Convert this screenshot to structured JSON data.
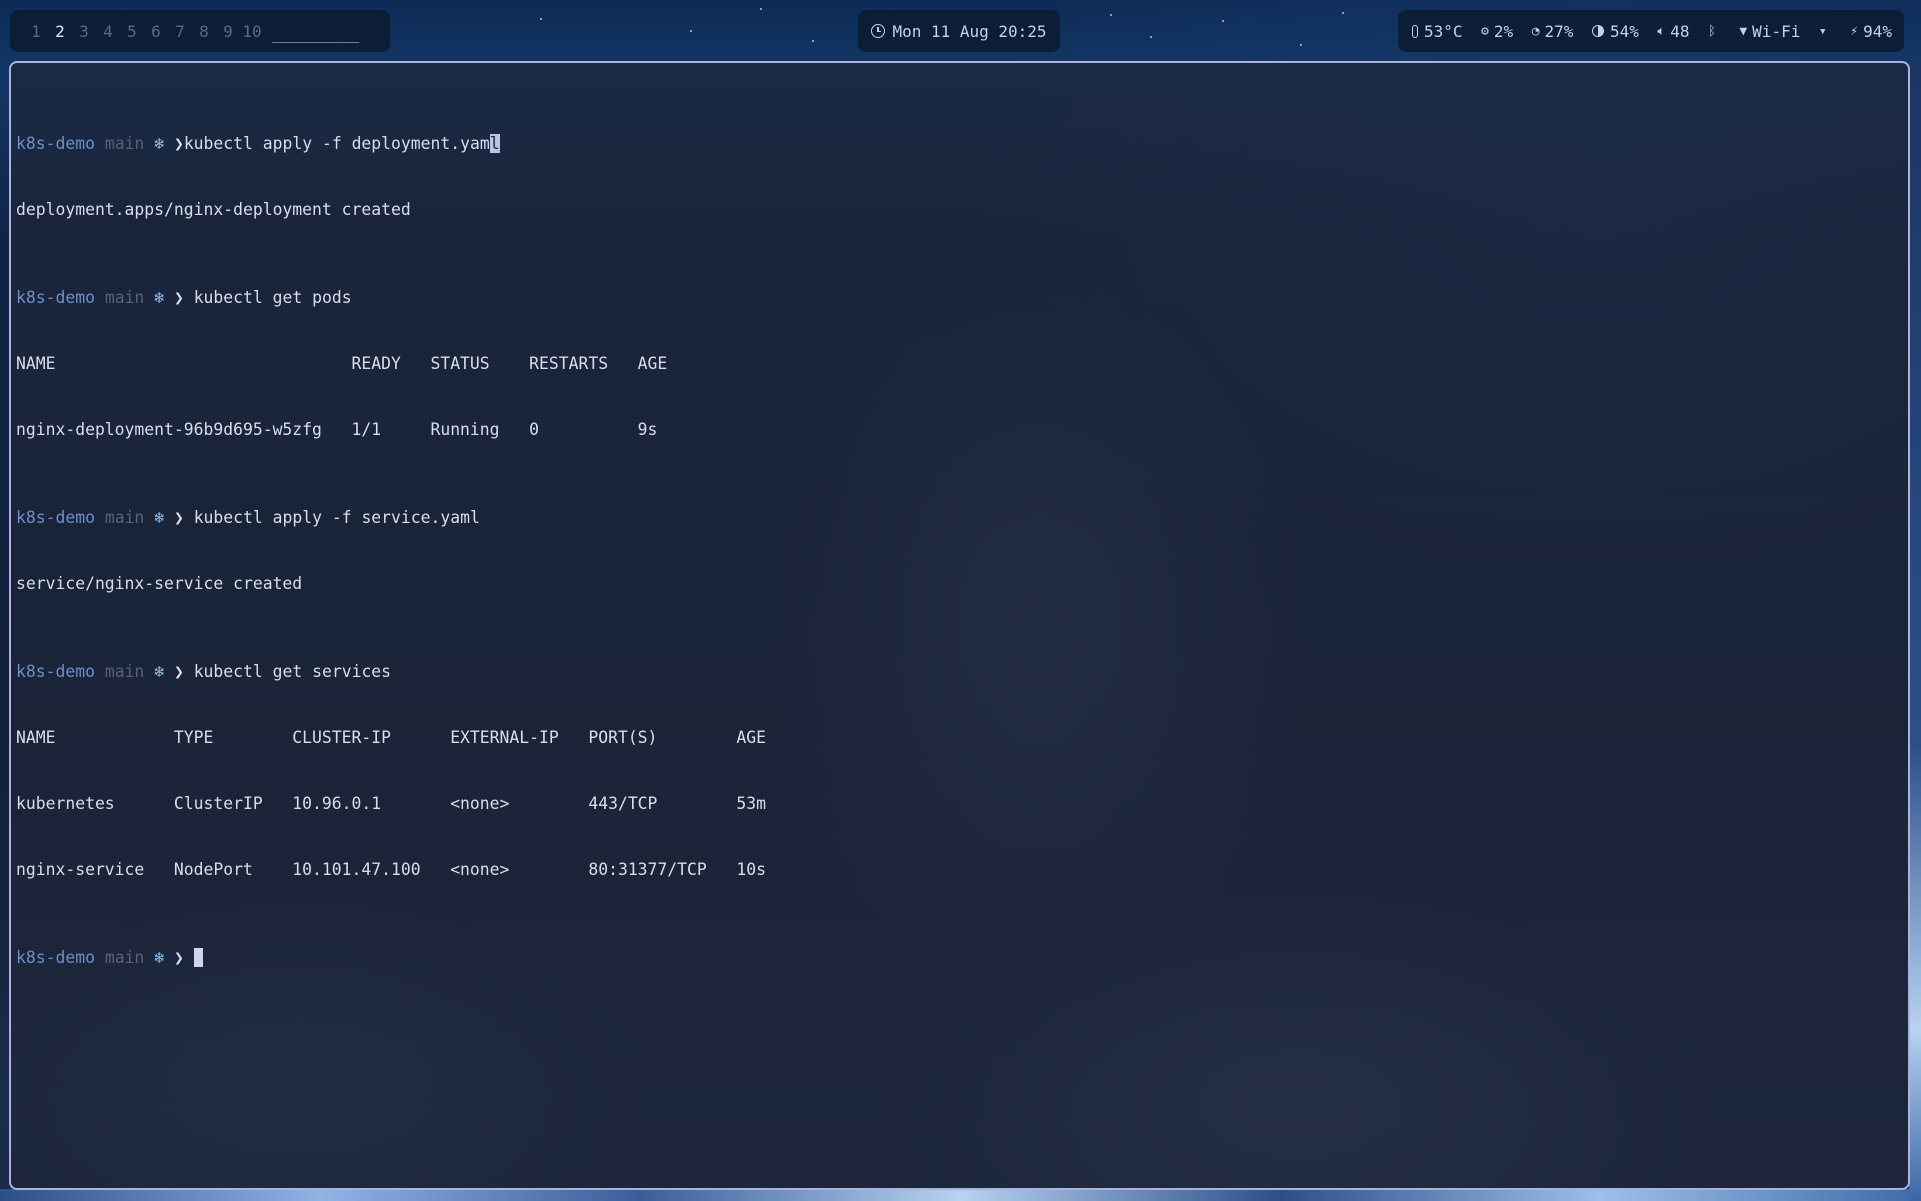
{
  "topbar": {
    "workspaces": [
      {
        "label": "1",
        "active": false
      },
      {
        "label": "2",
        "active": true
      },
      {
        "label": "3",
        "active": false
      },
      {
        "label": "4",
        "active": false
      },
      {
        "label": "5",
        "active": false
      },
      {
        "label": "6",
        "active": false
      },
      {
        "label": "7",
        "active": false
      },
      {
        "label": "8",
        "active": false
      },
      {
        "label": "9",
        "active": false
      },
      {
        "label": "10",
        "active": false
      }
    ],
    "taskbar_placeholder": "__________",
    "clock": "Mon 11 Aug 20:25",
    "status": {
      "temperature": "53°C",
      "cpu": "2%",
      "memory": "27%",
      "brightness": "54%",
      "volume": "48",
      "network": "Wi-Fi",
      "battery": "94%"
    }
  },
  "terminal": {
    "prompt": {
      "dir": "k8s-demo",
      "branch": "main",
      "k8s_icon": "❄",
      "chevron": "❯"
    },
    "commands": {
      "c1_a": "kubectl apply -f deployment.yam",
      "c1_b": "l",
      "c2": "kubectl get pods",
      "c3": "kubectl apply -f service.yaml",
      "c4": "kubectl get services"
    },
    "outputs": {
      "deploy_created": "deployment.apps/nginx-deployment created",
      "service_created": "service/nginx-service created"
    },
    "pods_table": {
      "header": "NAME                              READY   STATUS    RESTARTS   AGE",
      "rows": [
        "nginx-deployment-96b9d695-w5zfg   1/1     Running   0          9s"
      ]
    },
    "services_table": {
      "header": "NAME            TYPE        CLUSTER-IP      EXTERNAL-IP   PORT(S)        AGE",
      "rows": [
        "kubernetes      ClusterIP   10.96.0.1       <none>        443/TCP        53m",
        "nginx-service   NodePort    10.101.47.100   <none>        80:31377/TCP   10s"
      ]
    }
  },
  "colors": {
    "prompt_dir": "#6e8fc9",
    "prompt_branch": "#56617a",
    "k8s_icon": "#8ec1f0",
    "terminal_text": "#d8dee9",
    "window_border": "#a9b4dc"
  }
}
